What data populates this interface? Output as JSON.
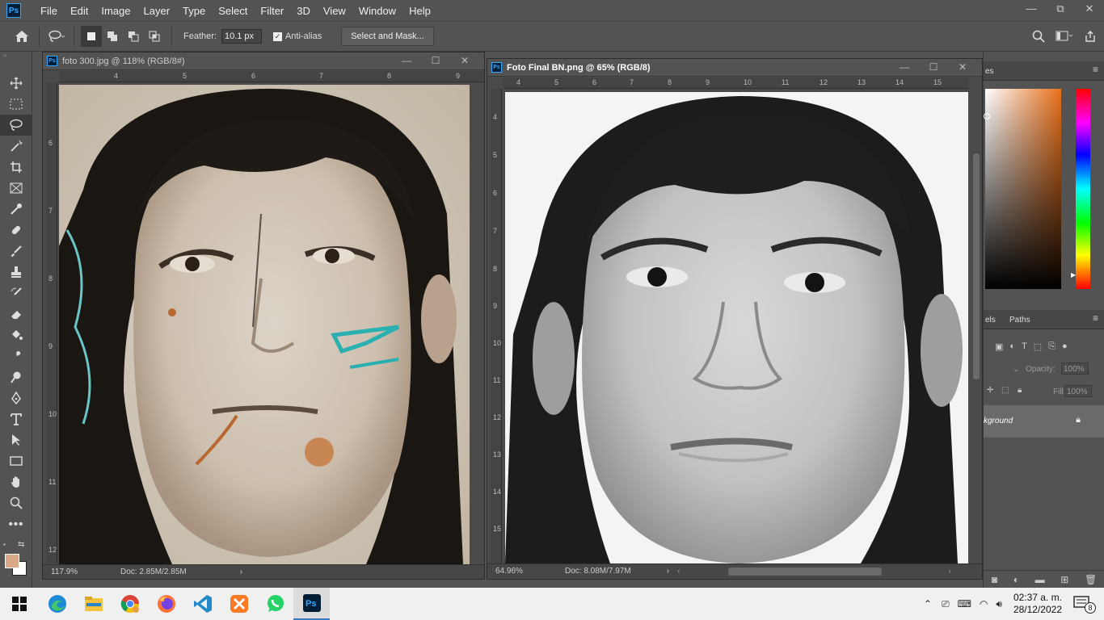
{
  "app": {
    "logo_text": "Ps"
  },
  "menu": [
    "File",
    "Edit",
    "Image",
    "Layer",
    "Type",
    "Select",
    "Filter",
    "3D",
    "View",
    "Window",
    "Help"
  ],
  "window_controls": {
    "minimize": "—",
    "restore": "⧉",
    "close": "✕"
  },
  "options_bar": {
    "feather_label": "Feather:",
    "feather_value": "10.1 px",
    "antialias_label": "Anti-alias",
    "antialias_checked": true,
    "select_mask_label": "Select and Mask..."
  },
  "documents": [
    {
      "title": "foto 300.jpg @ 118% (RGB/8#)",
      "zoom": "117.9%",
      "doc_size": "Doc: 2.85M/2.85M",
      "ruler_h": [
        "4",
        "5",
        "6",
        "7",
        "8",
        "9"
      ],
      "ruler_v": [
        "6",
        "7",
        "8",
        "9",
        "10",
        "11",
        "12"
      ]
    },
    {
      "title": "Foto Final BN.png @ 65% (RGB/8)",
      "zoom": "64.96%",
      "doc_size": "Doc: 8.08M/7.97M",
      "ruler_h": [
        "4",
        "5",
        "6",
        "7",
        "8",
        "9",
        "10",
        "11",
        "12",
        "13",
        "14",
        "15"
      ],
      "ruler_v": [
        "4",
        "5",
        "6",
        "7",
        "8",
        "9",
        "10",
        "11",
        "12",
        "13",
        "14",
        "15"
      ]
    }
  ],
  "panels": {
    "top_tab_fragment": "es",
    "layers_tab_fragment": "els",
    "paths_tab": "Paths",
    "opacity_label": "Opacity:",
    "opacity_value": "100%",
    "fill_label": "Fill:",
    "fill_value": "100%",
    "layer_name_fragment": "kground"
  },
  "colors": {
    "foreground": "#d8a888",
    "background": "#ffffff",
    "ps_blue": "#31a8ff"
  },
  "taskbar": {
    "apps": [
      "edge-icon",
      "file-explorer-icon",
      "chrome-icon",
      "firefox-icon",
      "vscode-icon",
      "xampp-icon",
      "whatsapp-icon",
      "photoshop-icon"
    ],
    "time": "02:37 a. m.",
    "date": "28/12/2022",
    "notifications": "8"
  }
}
